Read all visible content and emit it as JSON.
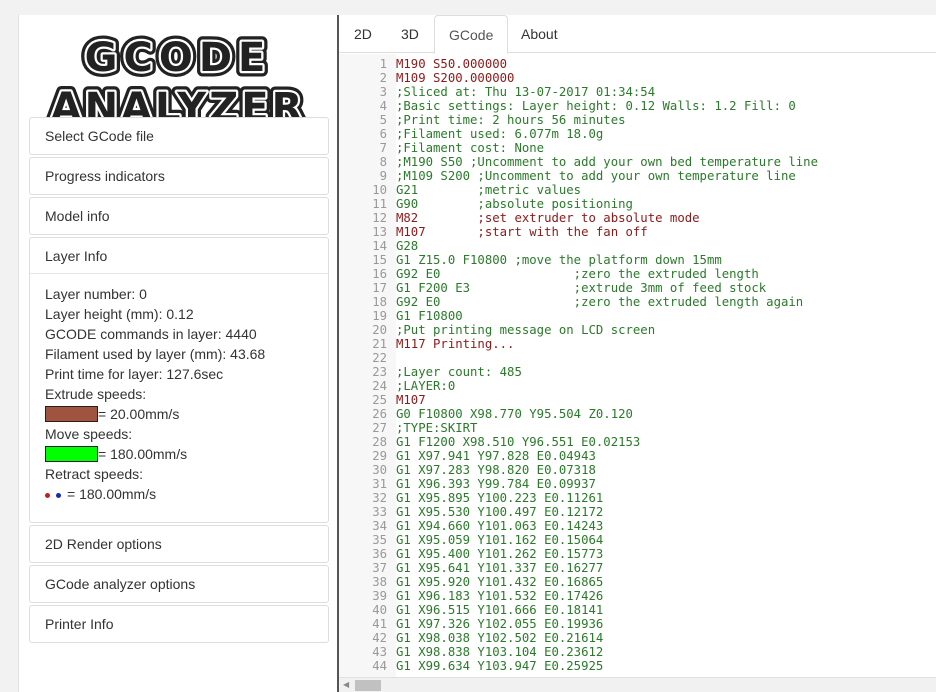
{
  "logo": {
    "line1": "GCODE",
    "line2": "ANALYZER"
  },
  "menu": {
    "select_file": "Select GCode file",
    "progress": "Progress indicators",
    "model_info": "Model info",
    "layer_info": "Layer Info",
    "render_options": "2D Render options",
    "analyzer_options": "GCode analyzer options",
    "printer_info": "Printer Info"
  },
  "layer": {
    "layer_number": "Layer number: 0",
    "layer_height": "Layer height (mm): 0.12",
    "commands": "GCODE commands in layer: 4440",
    "filament": "Filament used by layer (mm): 43.68",
    "print_time": "Print time for layer: 127.6sec",
    "extrude_label": "Extrude speeds:",
    "extrude_value": "= 20.00mm/s",
    "move_label": "Move speeds:",
    "move_value": "= 180.00mm/s",
    "retract_label": "Retract speeds:",
    "retract_value": "= 180.00mm/s"
  },
  "colors": {
    "extrude": "#a0533f",
    "move": "#00ff00",
    "retract_a": "#c0201f",
    "retract_b": "#1a2aa8",
    "gcode_command": "#8b1a1a",
    "gcode_comment": "#2b7a2b",
    "gcode_plain": "#333333"
  },
  "tabs": [
    "2D",
    "3D",
    "GCode",
    "About"
  ],
  "active_tab": "GCode",
  "gcode": [
    {
      "n": "1",
      "t": "M190 S50.000000",
      "k": "cmd"
    },
    {
      "n": "2",
      "t": "M109 S200.000000",
      "k": "cmd"
    },
    {
      "n": "3",
      "t": ";Sliced at: Thu 13-07-2017 01:34:54",
      "k": "cmt"
    },
    {
      "n": "4",
      "t": ";Basic settings: Layer height: 0.12 Walls: 1.2 Fill: 0",
      "k": "cmt"
    },
    {
      "n": "5",
      "t": ";Print time: 2 hours 56 minutes",
      "k": "cmt"
    },
    {
      "n": "6",
      "t": ";Filament used: 6.077m 18.0g",
      "k": "cmt"
    },
    {
      "n": "7",
      "t": ";Filament cost: None",
      "k": "cmt"
    },
    {
      "n": "8",
      "t": ";M190 S50 ;Uncomment to add your own bed temperature line",
      "k": "cmt"
    },
    {
      "n": "9",
      "t": ";M109 S200 ;Uncomment to add your own temperature line",
      "k": "cmt"
    },
    {
      "n": "10",
      "t": "G21        ;metric values",
      "k": "cmt"
    },
    {
      "n": "11",
      "t": "G90        ;absolute positioning",
      "k": "cmt"
    },
    {
      "n": "12",
      "t": "M82        ;set extruder to absolute mode",
      "k": "cmd"
    },
    {
      "n": "13",
      "t": "M107       ;start with the fan off",
      "k": "cmd"
    },
    {
      "n": "14",
      "t": "G28",
      "k": "cmt"
    },
    {
      "n": "15",
      "t": "G1 Z15.0 F10800 ;move the platform down 15mm",
      "k": "cmt"
    },
    {
      "n": "16",
      "t": "G92 E0                  ;zero the extruded length",
      "k": "cmt"
    },
    {
      "n": "17",
      "t": "G1 F200 E3              ;extrude 3mm of feed stock",
      "k": "cmt"
    },
    {
      "n": "18",
      "t": "G92 E0                  ;zero the extruded length again",
      "k": "cmt"
    },
    {
      "n": "19",
      "t": "G1 F10800",
      "k": "cmt"
    },
    {
      "n": "20",
      "t": ";Put printing message on LCD screen",
      "k": "cmt"
    },
    {
      "n": "21",
      "t": "M117 Printing...",
      "k": "cmd"
    },
    {
      "n": "22",
      "t": "",
      "k": "cmt"
    },
    {
      "n": "23",
      "t": ";Layer count: 485",
      "k": "cmt"
    },
    {
      "n": "24",
      "t": ";LAYER:0",
      "k": "cmt"
    },
    {
      "n": "25",
      "t": "M107",
      "k": "cmd"
    },
    {
      "n": "26",
      "t": "G0 F10800 X98.770 Y95.504 Z0.120",
      "k": "cmt"
    },
    {
      "n": "27",
      "t": ";TYPE:SKIRT",
      "k": "cmt"
    },
    {
      "n": "28",
      "t": "G1 F1200 X98.510 Y96.551 E0.02153",
      "k": "cmt"
    },
    {
      "n": "29",
      "t": "G1 X97.941 Y97.828 E0.04943",
      "k": "cmt"
    },
    {
      "n": "30",
      "t": "G1 X97.283 Y98.820 E0.07318",
      "k": "cmt"
    },
    {
      "n": "31",
      "t": "G1 X96.393 Y99.784 E0.09937",
      "k": "cmt"
    },
    {
      "n": "32",
      "t": "G1 X95.895 Y100.223 E0.11261",
      "k": "cmt"
    },
    {
      "n": "33",
      "t": "G1 X95.530 Y100.497 E0.12172",
      "k": "cmt"
    },
    {
      "n": "34",
      "t": "G1 X94.660 Y101.063 E0.14243",
      "k": "cmt"
    },
    {
      "n": "35",
      "t": "G1 X95.059 Y101.162 E0.15064",
      "k": "cmt"
    },
    {
      "n": "36",
      "t": "G1 X95.400 Y101.262 E0.15773",
      "k": "cmt"
    },
    {
      "n": "37",
      "t": "G1 X95.641 Y101.337 E0.16277",
      "k": "cmt"
    },
    {
      "n": "38",
      "t": "G1 X95.920 Y101.432 E0.16865",
      "k": "cmt"
    },
    {
      "n": "39",
      "t": "G1 X96.183 Y101.532 E0.17426",
      "k": "cmt"
    },
    {
      "n": "40",
      "t": "G1 X96.515 Y101.666 E0.18141",
      "k": "cmt"
    },
    {
      "n": "41",
      "t": "G1 X97.326 Y102.055 E0.19936",
      "k": "cmt"
    },
    {
      "n": "42",
      "t": "G1 X98.038 Y102.502 E0.21614",
      "k": "cmt"
    },
    {
      "n": "43",
      "t": "G1 X98.838 Y103.104 E0.23612",
      "k": "cmt"
    },
    {
      "n": "44",
      "t": "G1 X99.634 Y103.947 E0.25925",
      "k": "cmt"
    }
  ]
}
